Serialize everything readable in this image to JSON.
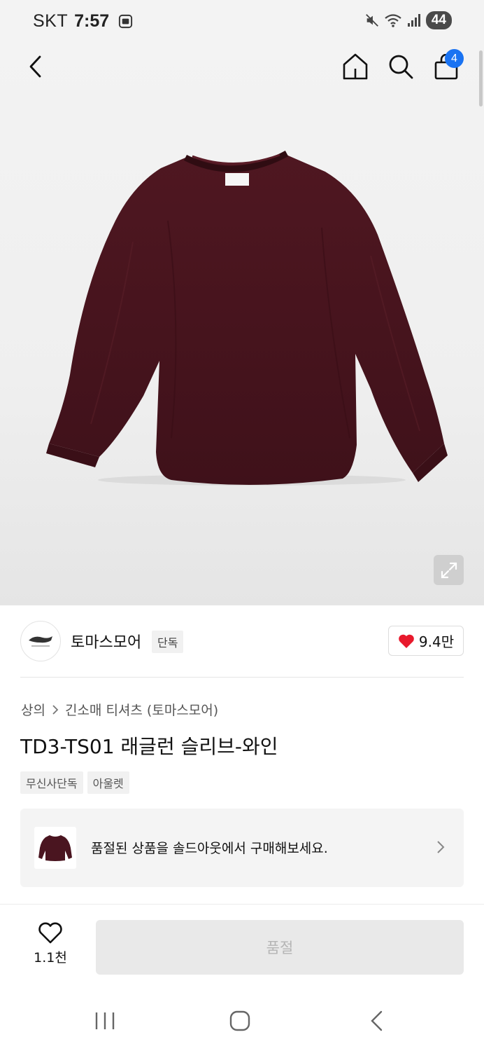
{
  "status_bar": {
    "carrier": "SKT",
    "time": "7:57",
    "battery": "44"
  },
  "header": {
    "cart_badge": "4"
  },
  "brand": {
    "name": "토마스모어",
    "exclusive_tag": "단독",
    "like_count": "9.4만"
  },
  "breadcrumb": {
    "category": "상의",
    "subcategory": "긴소매 티셔츠 (토마스모어)"
  },
  "product": {
    "title": "TD3-TS01 래글런 슬리브-와인",
    "tags": [
      "무신사단독",
      "아울렛"
    ],
    "color": "#4a1520"
  },
  "soldout_notice": {
    "text": "품절된 상품을 솔드아웃에서 구매해보세요."
  },
  "bottom_bar": {
    "wish_count": "1.1천",
    "primary_button": "품절"
  },
  "colors": {
    "badge_blue": "#1a73f2",
    "heart_red": "#e8192c"
  }
}
